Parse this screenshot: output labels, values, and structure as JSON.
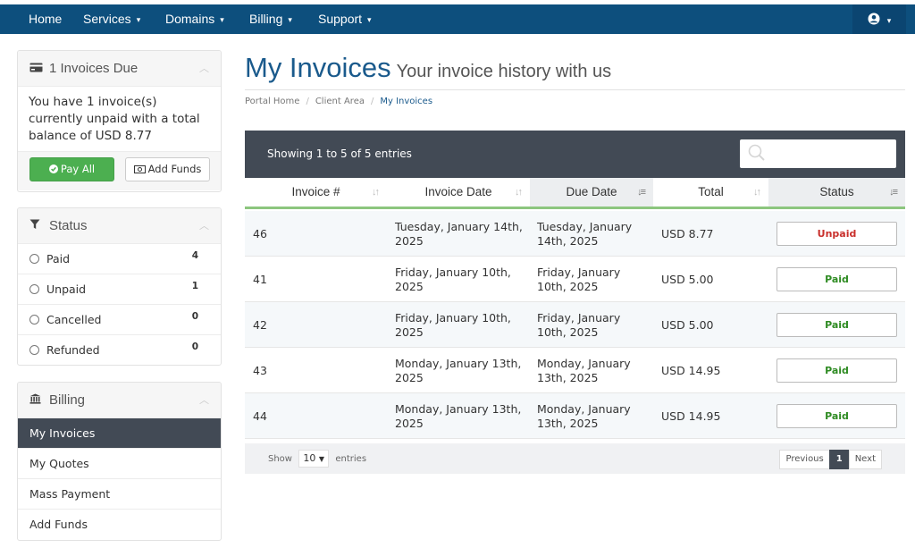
{
  "nav": {
    "items": [
      {
        "label": "Home",
        "dropdown": false
      },
      {
        "label": "Services",
        "dropdown": true
      },
      {
        "label": "Domains",
        "dropdown": true
      },
      {
        "label": "Billing",
        "dropdown": true
      },
      {
        "label": "Support",
        "dropdown": true
      }
    ],
    "account_icon": "user-circle-icon",
    "caret": "▾"
  },
  "sidebar": {
    "due": {
      "title": "1 Invoices Due",
      "text": "You have 1 invoice(s) currently unpaid with a total balance of USD 8.77",
      "pay_all": "Pay All",
      "add_funds": "Add Funds"
    },
    "status": {
      "title": "Status",
      "items": [
        {
          "label": "Paid",
          "count": "4"
        },
        {
          "label": "Unpaid",
          "count": "1"
        },
        {
          "label": "Cancelled",
          "count": "0"
        },
        {
          "label": "Refunded",
          "count": "0"
        }
      ]
    },
    "billing": {
      "title": "Billing",
      "items": [
        {
          "label": "My Invoices",
          "active": true
        },
        {
          "label": "My Quotes",
          "active": false
        },
        {
          "label": "Mass Payment",
          "active": false
        },
        {
          "label": "Add Funds",
          "active": false
        }
      ]
    }
  },
  "main": {
    "title": "My Invoices",
    "subtitle": "Your invoice history with us",
    "breadcrumb": [
      "Portal Home",
      "Client Area",
      "My Invoices"
    ],
    "table": {
      "info": "Showing 1 to 5 of 5 entries",
      "search_placeholder": "",
      "columns": [
        "Invoice #",
        "Invoice Date",
        "Due Date",
        "Total",
        "Status"
      ],
      "rows": [
        {
          "id": "46",
          "invoice_date": "Tuesday, January 14th, 2025",
          "due_date": "Tuesday, January 14th, 2025",
          "total": "USD 8.77",
          "status": "Unpaid"
        },
        {
          "id": "41",
          "invoice_date": "Friday, January 10th, 2025",
          "due_date": "Friday, January 10th, 2025",
          "total": "USD 5.00",
          "status": "Paid"
        },
        {
          "id": "42",
          "invoice_date": "Friday, January 10th, 2025",
          "due_date": "Friday, January 10th, 2025",
          "total": "USD 5.00",
          "status": "Paid"
        },
        {
          "id": "43",
          "invoice_date": "Monday, January 13th, 2025",
          "due_date": "Monday, January 13th, 2025",
          "total": "USD 14.95",
          "status": "Paid"
        },
        {
          "id": "44",
          "invoice_date": "Monday, January 13th, 2025",
          "due_date": "Monday, January 13th, 2025",
          "total": "USD 14.95",
          "status": "Paid"
        }
      ],
      "footer": {
        "show": "Show",
        "page_size": "10",
        "entries": "entries",
        "previous": "Previous",
        "current_page": "1",
        "next": "Next"
      }
    }
  },
  "colors": {
    "nav_bg": "#0d4f7d",
    "table_header_bg": "#424a55",
    "accent_green": "#8cc67e",
    "unpaid": "#c9302c",
    "paid": "#2e8b22",
    "title_blue": "#1a5a8c"
  }
}
